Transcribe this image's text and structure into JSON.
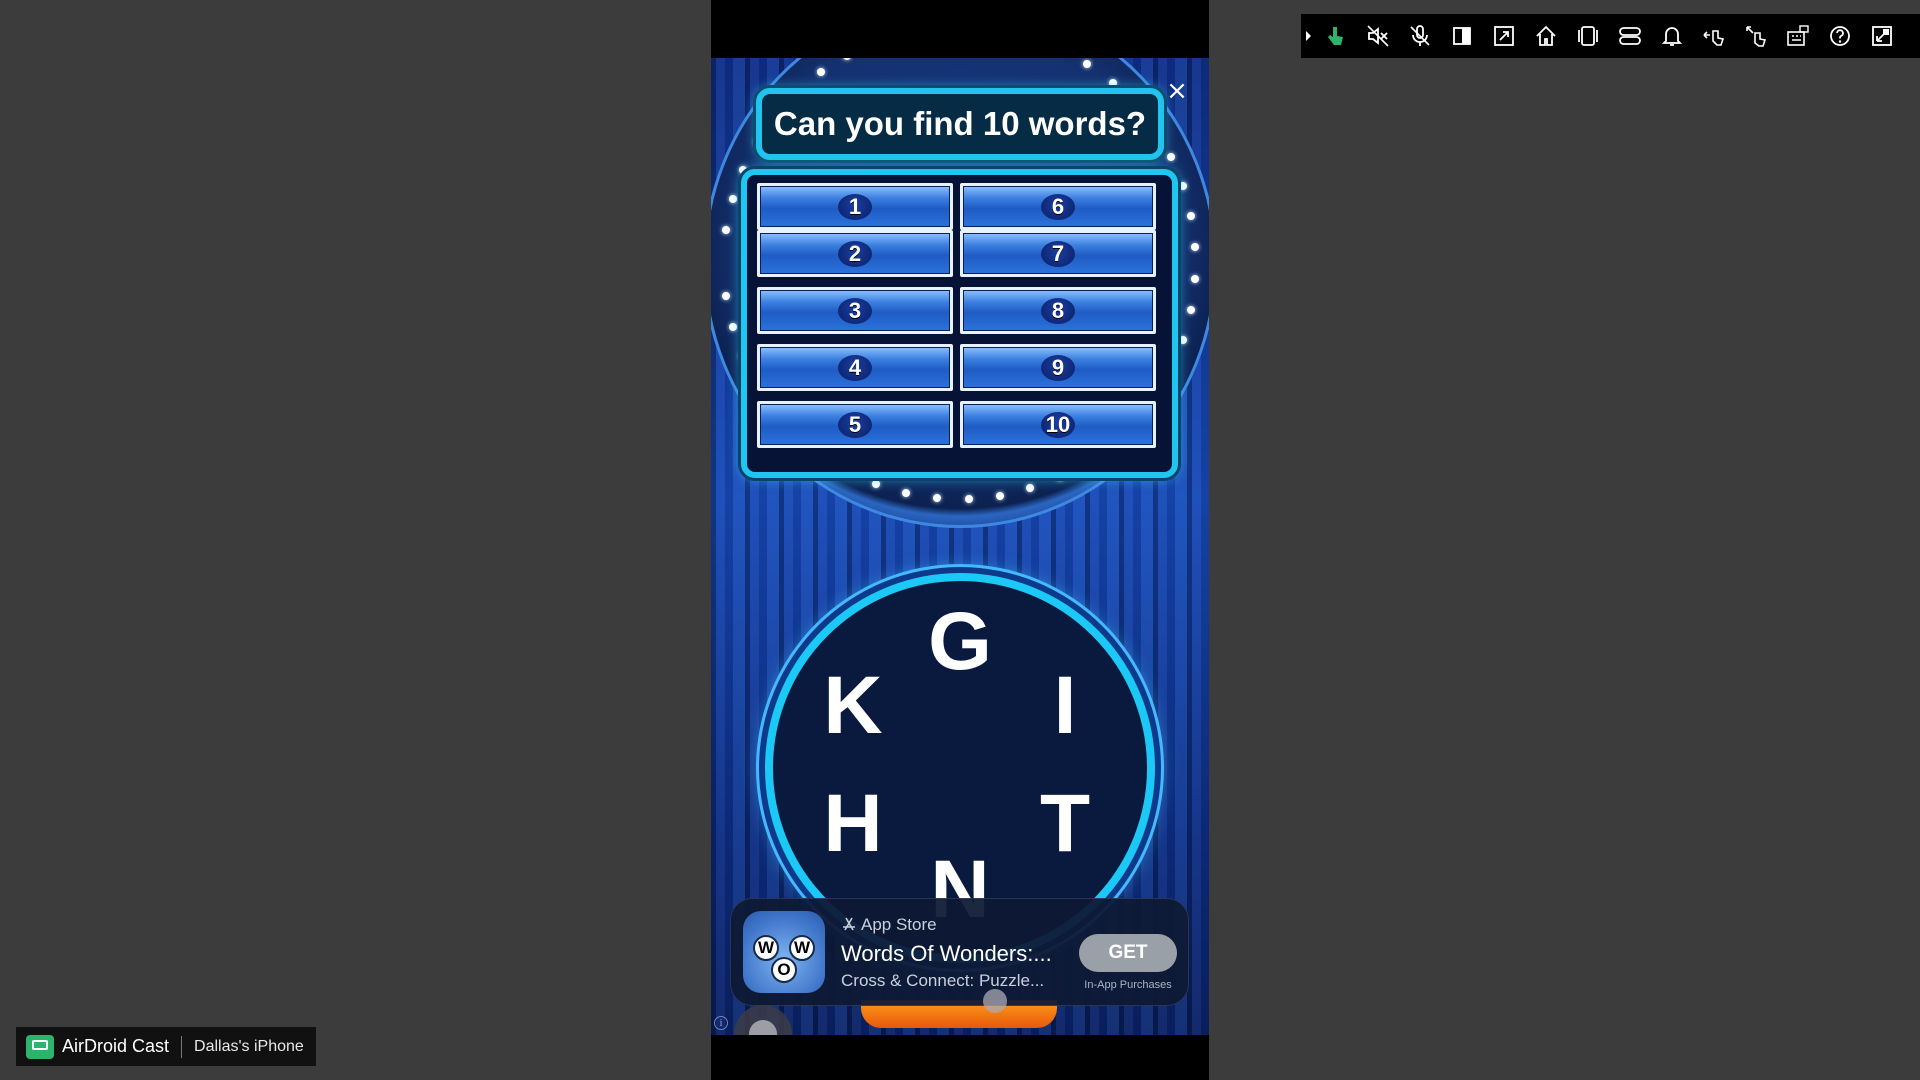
{
  "game": {
    "title": "Can you find 10 words?",
    "close_icon": "×",
    "slots_left": [
      "1",
      "2",
      "3",
      "4",
      "5"
    ],
    "slots_right": [
      "6",
      "7",
      "8",
      "9",
      "10"
    ],
    "letters": [
      "G",
      "I",
      "T",
      "N",
      "H",
      "K"
    ]
  },
  "ad": {
    "store_label": "App Store",
    "app_title": "Words Of Wonders:...",
    "app_subtitle": "Cross & Connect: Puzzle...",
    "get_label": "GET",
    "iap_label": "In-App Purchases",
    "icon_letters": [
      "W",
      "W",
      "O"
    ]
  },
  "info_icon": "i",
  "toolbar": {
    "icons": [
      "expand-toolbar-icon",
      "touch-control-icon",
      "speaker-mute-icon",
      "mic-mute-icon",
      "screenshot-icon",
      "fit-window-icon",
      "home-icon",
      "app-switcher-icon",
      "control-center-icon",
      "notification-icon",
      "back-gesture-icon",
      "forward-gesture-icon",
      "keyboard-mapping-icon",
      "help-icon",
      "fullscreen-exit-icon"
    ],
    "accent": "#2db36b"
  },
  "badge": {
    "brand": "AirDroid Cast",
    "device": "Dallas's iPhone"
  }
}
